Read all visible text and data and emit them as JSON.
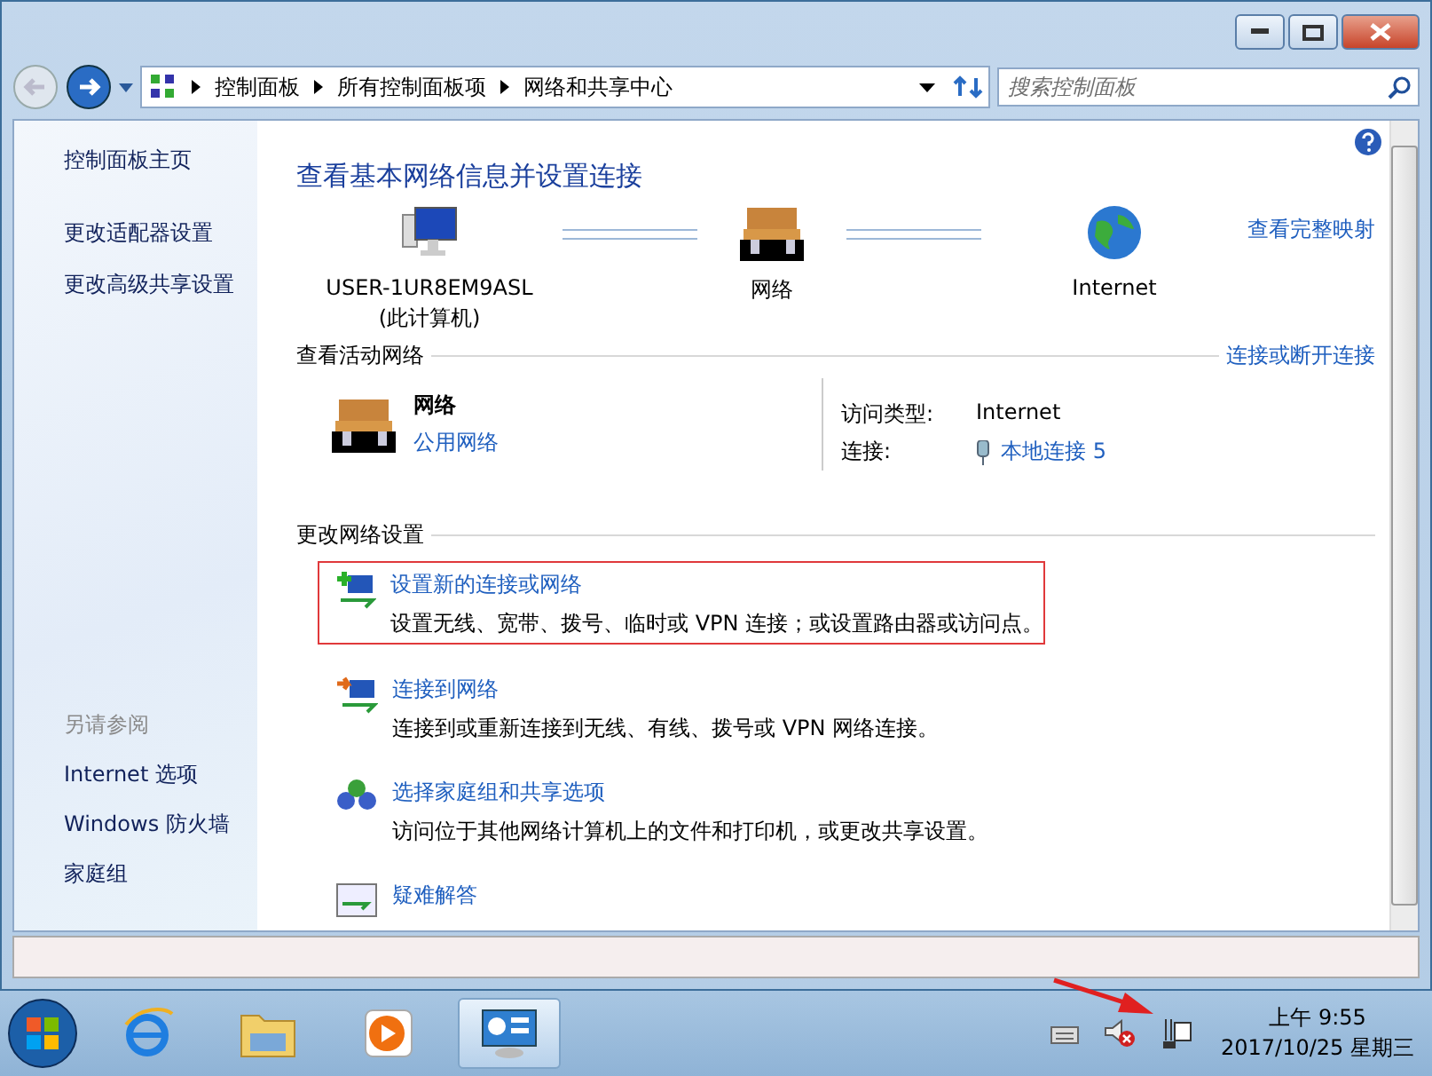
{
  "address_bar": {
    "breadcrumbs": [
      "控制面板",
      "所有控制面板项",
      "网络和共享中心"
    ]
  },
  "search": {
    "placeholder": "搜索控制面板"
  },
  "sidebar": {
    "items": [
      "控制面板主页",
      "更改适配器设置",
      "更改高级共享设置"
    ],
    "see_also": {
      "title": "另请参阅",
      "items": [
        "Internet 选项",
        "Windows 防火墙",
        "家庭组"
      ]
    }
  },
  "main": {
    "heading": "查看基本网络信息并设置连接",
    "full_map_link": "查看完整映射",
    "map_nodes": [
      {
        "kind": "computer",
        "label": "USER-1UR8EM9ASL",
        "sublabel": "(此计算机)"
      },
      {
        "kind": "network",
        "label": "网络"
      },
      {
        "kind": "internet",
        "label": "Internet"
      }
    ],
    "active_networks": {
      "title": "查看活动网络",
      "link": "连接或断开连接",
      "network": {
        "name": "网络",
        "type": "公用网络"
      },
      "access_type": {
        "label": "访问类型:",
        "value": "Internet"
      },
      "connection": {
        "label": "连接:",
        "value": "本地连接 5"
      }
    },
    "change_settings": {
      "title": "更改网络设置",
      "tasks": [
        {
          "kind": "setup",
          "title": "设置新的连接或网络",
          "description": "设置无线、宽带、拨号、临时或 VPN 连接；或设置路由器或访问点。",
          "highlighted": true
        },
        {
          "kind": "connect",
          "title": "连接到网络",
          "description": "连接到或重新连接到无线、有线、拨号或 VPN 网络连接。",
          "highlighted": false
        },
        {
          "kind": "homegroup",
          "title": "选择家庭组和共享选项",
          "description": "访问位于其他网络计算机上的文件和打印机，或更改共享设置。",
          "highlighted": false
        },
        {
          "kind": "troubleshoot",
          "title": "疑难解答",
          "highlighted": false
        }
      ]
    }
  },
  "taskbar": {
    "apps": [
      {
        "kind": "browser",
        "selected": false
      },
      {
        "kind": "folder",
        "selected": false
      },
      {
        "kind": "media",
        "selected": false
      },
      {
        "kind": "control-panel",
        "selected": true
      }
    ],
    "tray": [
      {
        "kind": "keyboard"
      },
      {
        "kind": "volume-muted"
      },
      {
        "kind": "network"
      }
    ],
    "clock": {
      "time": "上午 9:55",
      "date": "2017/10/25 星期三"
    }
  }
}
